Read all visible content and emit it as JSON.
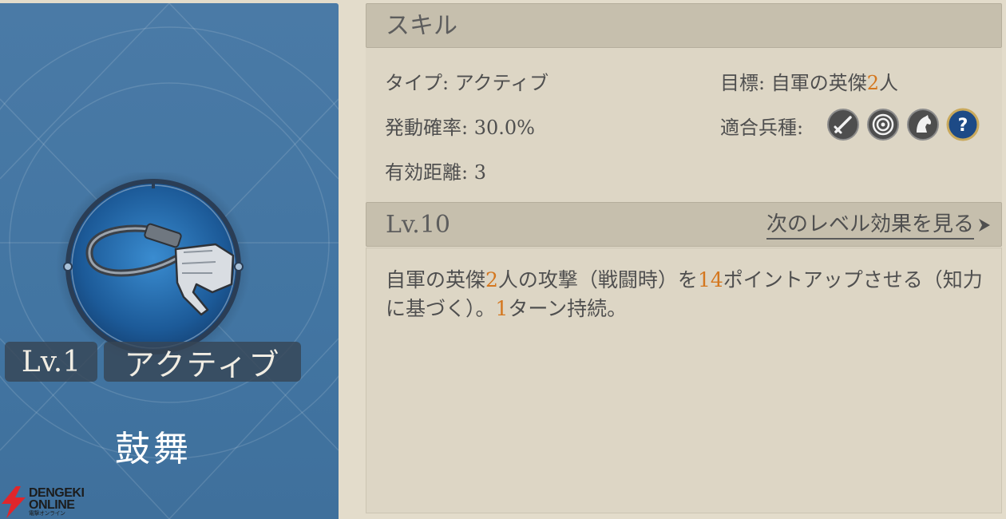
{
  "skill_card": {
    "level_label": "Lv.1",
    "type_label": "アクティブ",
    "name": "鼓舞",
    "icon": "whip-in-hand-icon"
  },
  "watermark": {
    "line1": "DENGEKI",
    "line2": "ONLINE",
    "line3": "電撃オンライン",
    "icon": "lightning-bolt-icon"
  },
  "skill_section": {
    "title": "スキル",
    "type_label": "タイプ:",
    "type_value": "アクティブ",
    "activation_label": "発動確率:",
    "activation_value": "30.0%",
    "range_label": "有効距離:",
    "range_value": "3",
    "target_label": "目標:",
    "target_prefix": "自軍の英傑",
    "target_count": "2",
    "target_suffix": "人",
    "units_label": "適合兵種:",
    "unit_icons": [
      "sword-icon",
      "bow-target-icon",
      "horse-icon",
      "question-icon"
    ]
  },
  "level_section": {
    "title": "Lv.10",
    "next_link": "次のレベル効果を見る",
    "arrow_icon": "chevron-right-icon"
  },
  "description": {
    "p1": "自軍の英傑",
    "n1": "2",
    "p2": "人の攻撃（戦闘時）を",
    "n2": "14",
    "p3": "ポイントアップさせる（知力に基づく）。",
    "n3": "1",
    "p4": "ターン持続。"
  },
  "colors": {
    "card_blue": "#4a7aa6",
    "highlight": "#d4771f",
    "panel": "#ddd6c5",
    "header": "#c6bfad"
  }
}
